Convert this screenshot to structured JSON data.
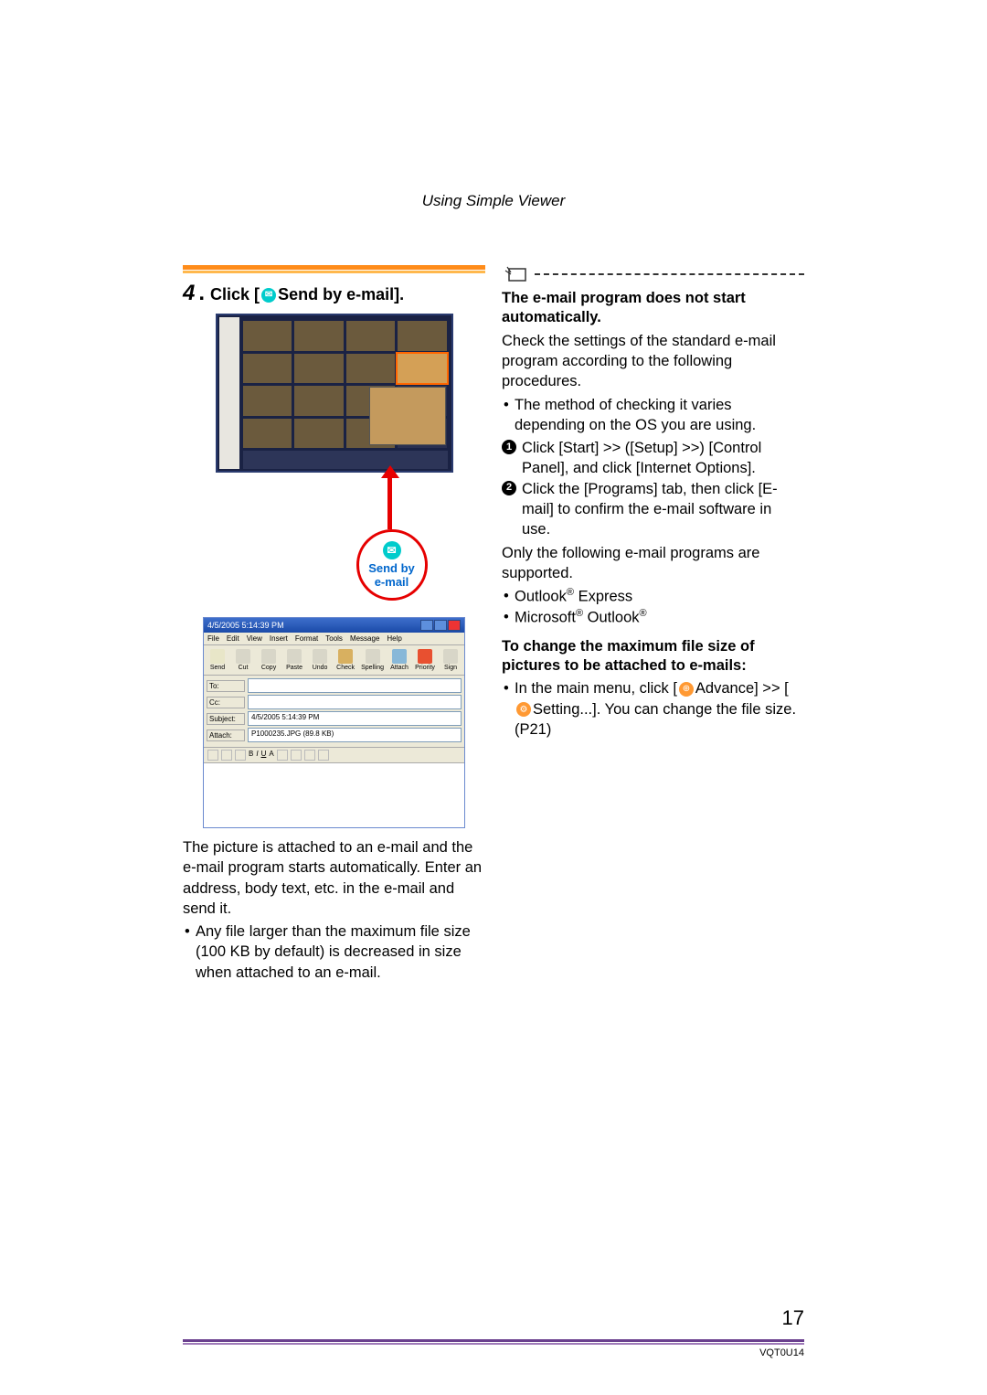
{
  "section_header": "Using Simple Viewer",
  "step": {
    "number": "4",
    "label_prefix": "Click [",
    "label_action": "Send by e-mail].",
    "callout_line1": "Send by",
    "callout_line2": "e-mail"
  },
  "email_window": {
    "title": "4/5/2005 5:14:39 PM",
    "menu": [
      "File",
      "Edit",
      "View",
      "Insert",
      "Format",
      "Tools",
      "Message",
      "Help"
    ],
    "toolbar": [
      {
        "label": "Send",
        "color": "#e8e6c8"
      },
      {
        "label": "Cut",
        "color": "#d8d6c8"
      },
      {
        "label": "Copy",
        "color": "#d8d6c8"
      },
      {
        "label": "Paste",
        "color": "#d8d6c8"
      },
      {
        "label": "Undo",
        "color": "#d8d6c8"
      },
      {
        "label": "Check",
        "color": "#d8b060"
      },
      {
        "label": "Spelling",
        "color": "#d8d6c8"
      },
      {
        "label": "Attach",
        "color": "#88b8d8"
      },
      {
        "label": "Priority",
        "color": "#e85030"
      },
      {
        "label": "Sign",
        "color": "#d8d6c8"
      }
    ],
    "fields": {
      "to": "To:",
      "cc": "Cc:",
      "subject_lbl": "Subject:",
      "subject_val": "4/5/2005 5:14:39 PM",
      "attach_lbl": "Attach:",
      "attach_val": "P1000235.JPG (89.8 KB)"
    }
  },
  "left_body1": "The picture is attached to an e-mail and the e-mail program starts automatically. Enter an address, body text, etc. in the e-mail and send it.",
  "left_bullet1": "Any file larger than the maximum file size (100 KB by default) is decreased in size when attached to an e-mail.",
  "right": {
    "head1": "The e-mail program does not start automatically.",
    "body1": "Check the settings of the standard e-mail program according to the following procedures.",
    "bullet1": "The method of checking it varies depending on the OS you are using.",
    "num1": "Click [Start] >> ([Setup] >>) [Control Panel], and click [Internet Options].",
    "num2": "Click the [Programs] tab, then click [E-mail] to confirm the e-mail software in use.",
    "body2": "Only the following e-mail programs are supported.",
    "sup1a": "Outlook",
    "sup1b": " Express",
    "sup2a": "Microsoft",
    "sup2b": " Outlook",
    "head2": "To change the maximum file size of pictures to be attached to e-mails:",
    "adv1": "In the main menu, click [",
    "adv2": "Advance] >> [",
    "adv3": "Setting...]. You can change the file size. (P21)"
  },
  "footer": {
    "page": "17",
    "docid": "VQT0U14"
  }
}
